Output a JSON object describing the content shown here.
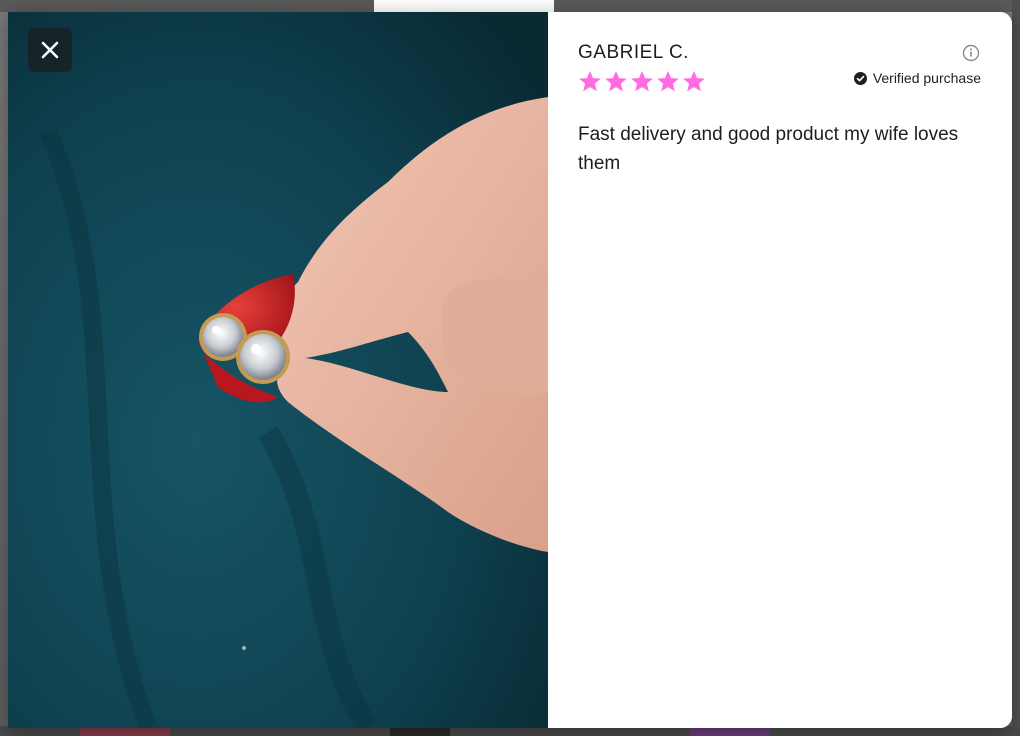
{
  "modal": {
    "close_icon": "close-icon",
    "review": {
      "reviewer_name": "GABRIEL C.",
      "rating": 5,
      "rating_max": 5,
      "star_color": "#ff6be3",
      "verified_label": "Verified purchase",
      "verified_icon": "check-circle-icon",
      "info_icon": "info-icon",
      "body": "Fast delivery and good product my wife loves them"
    },
    "photo": {
      "icon": "review-photo"
    }
  }
}
